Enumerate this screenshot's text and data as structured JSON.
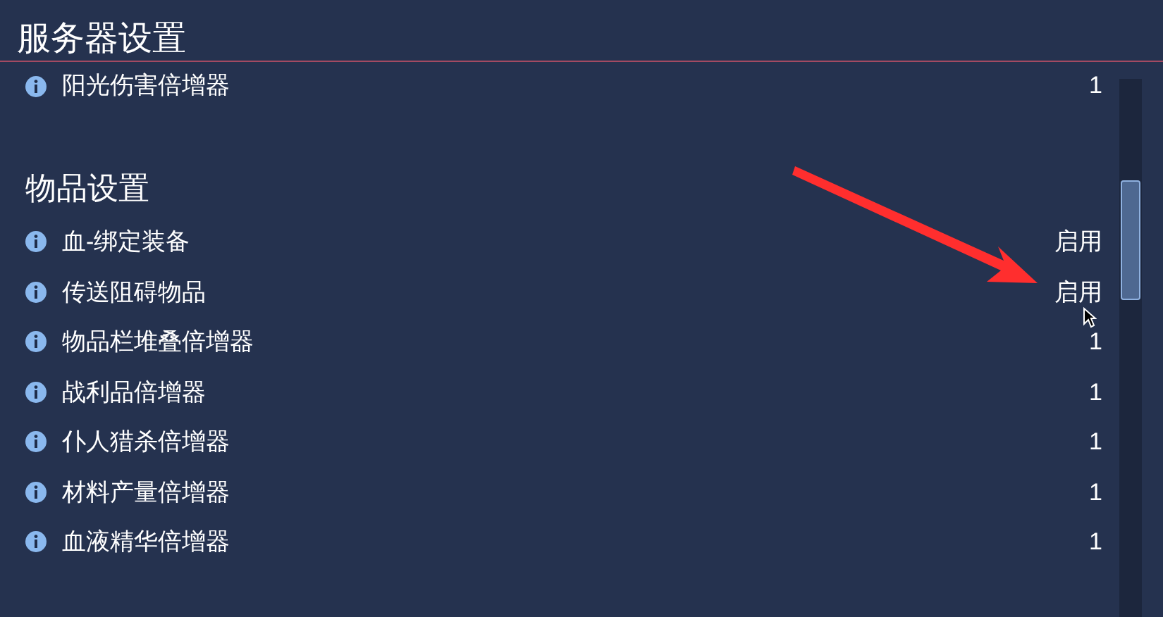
{
  "title": "服务器设置",
  "top_rows": [
    {
      "label": "阳光伤害倍增器",
      "value": "1"
    }
  ],
  "section": {
    "heading": "物品设置",
    "rows": [
      {
        "label": "血-绑定装备",
        "value": "启用"
      },
      {
        "label": "传送阻碍物品",
        "value": "启用"
      },
      {
        "label": "物品栏堆叠倍增器",
        "value": "1"
      },
      {
        "label": "战利品倍增器",
        "value": "1"
      },
      {
        "label": "仆人猎杀倍增器",
        "value": "1"
      },
      {
        "label": "材料产量倍增器",
        "value": "1"
      },
      {
        "label": "血液精华倍增器",
        "value": "1"
      }
    ]
  }
}
